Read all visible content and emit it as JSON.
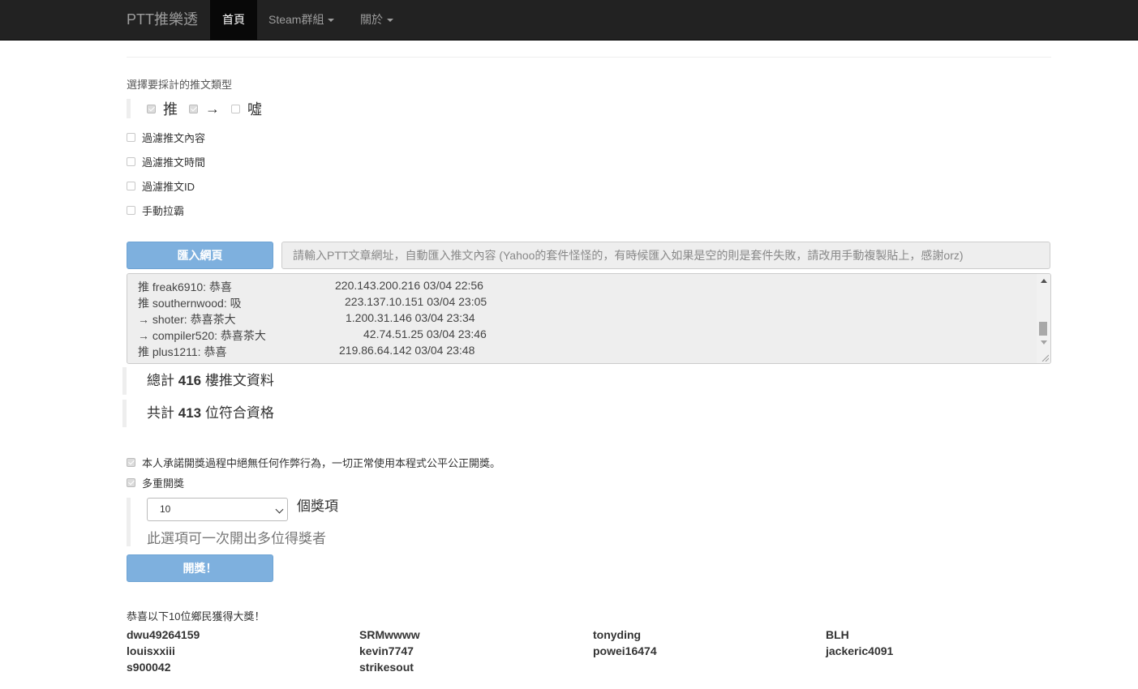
{
  "navbar": {
    "brand": "PTT推樂透",
    "home": "首頁",
    "steam": "Steam群組",
    "about": "關於"
  },
  "push_type": {
    "title": "選擇要採計的推文類型",
    "options": [
      {
        "symbol": "推",
        "checked": true
      },
      {
        "symbol": "→",
        "checked": true
      },
      {
        "symbol": "噓",
        "checked": false
      }
    ]
  },
  "filters": [
    {
      "label": "過濾推文內容",
      "checked": false
    },
    {
      "label": "過濾推文時間",
      "checked": false
    },
    {
      "label": "過濾推文ID",
      "checked": false
    },
    {
      "label": "手動拉霸",
      "checked": false
    }
  ],
  "import": {
    "button_label": "匯入網頁",
    "placeholder": "請輸入PTT文章網址，自動匯入推文內容 (Yahoo的套件怪怪的，有時候匯入如果是空的則是套件失敗，請改用手動複製貼上，感謝orz)"
  },
  "comments": [
    {
      "text": "推 freak6910: 恭喜",
      "meta": "220.143.200.216 03/04 22:56"
    },
    {
      "text": "推 southernwood: 吸",
      "meta": "223.137.10.151 03/04 23:05"
    },
    {
      "text": "→ shoter: 恭喜茶大",
      "meta": "1.200.31.146 03/04 23:34"
    },
    {
      "text": "→ compiler520: 恭喜茶大",
      "meta": "42.74.51.25 03/04 23:46"
    },
    {
      "text": "推 plus1211: 恭喜",
      "meta": "219.86.64.142 03/04 23:48"
    }
  ],
  "stats": {
    "total_prefix": "總計",
    "total_count": "416",
    "total_suffix": "樓推文資料",
    "qualified_prefix": "共計",
    "qualified_count": "413",
    "qualified_suffix": "位符合資格"
  },
  "agreement": {
    "pledge": "本人承諾開獎過程中絕無任何作弊行為，一切正常使用本程式公平公正開獎。",
    "pledge_checked": true,
    "multi": "多重開獎",
    "multi_checked": true
  },
  "prize": {
    "count": "10",
    "unit": "個獎項",
    "hint": "此選項可一次開出多位得獎者"
  },
  "draw_button": "開獎！",
  "results": {
    "title": "恭喜以下10位鄉民獲得大獎！",
    "winners": [
      "dwu49264159",
      "SRMwwww",
      "tonyding",
      "BLH",
      "louisxxiii",
      "kevin7747",
      "powei16474",
      "jackeric4091",
      "s900042",
      "strikesout"
    ]
  },
  "colors": {
    "navbar_bg": "#222222",
    "button_primary": "#7eb0de"
  }
}
